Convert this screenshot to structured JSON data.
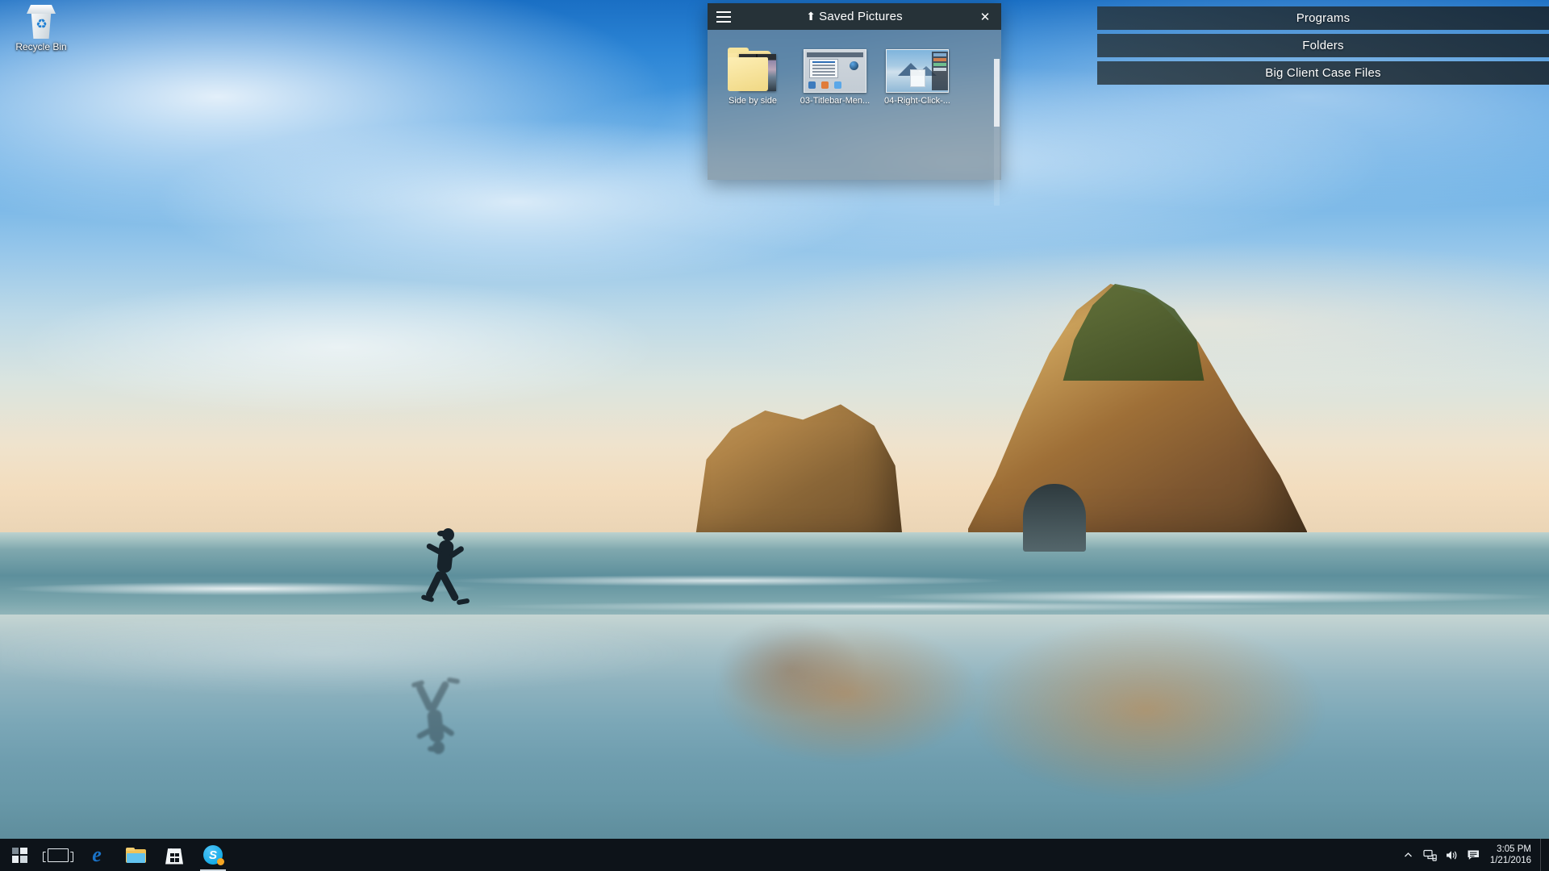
{
  "desktop": {
    "icons": [
      {
        "label": "Recycle Bin",
        "icon": "recycle-bin-icon"
      }
    ]
  },
  "explorer_window": {
    "title": "Saved Pictures",
    "title_prefix_icon": "up-arrow-icon",
    "menu_icon": "hamburger-menu-icon",
    "close_label": "✕",
    "files": [
      {
        "name": "Side by side",
        "type": "folder",
        "icon": "folder-with-preview-icon"
      },
      {
        "name": "03-Titlebar-Men...",
        "type": "image",
        "icon": "screenshot-thumbnail-icon"
      },
      {
        "name": "04-Right-Click-...",
        "type": "image",
        "icon": "screenshot-thumbnail-icon"
      }
    ]
  },
  "menu_bars": {
    "items": [
      {
        "label": "Programs"
      },
      {
        "label": "Folders"
      },
      {
        "label": "Big Client Case Files"
      }
    ]
  },
  "taskbar": {
    "buttons": [
      {
        "name": "start-button",
        "icon": "windows-start-icon"
      },
      {
        "name": "task-view-button",
        "icon": "task-view-icon"
      },
      {
        "name": "edge-button",
        "icon": "edge-browser-icon",
        "glyph": "e"
      },
      {
        "name": "file-explorer-button",
        "icon": "file-explorer-icon"
      },
      {
        "name": "store-button",
        "icon": "microsoft-store-icon"
      },
      {
        "name": "skype-button",
        "icon": "skype-icon",
        "glyph": "S",
        "running": true,
        "badge": true
      }
    ],
    "tray": [
      {
        "name": "show-hidden-icons",
        "icon": "chevron-up-icon",
        "glyph": "⌃"
      },
      {
        "name": "network-icon",
        "icon": "network-icon"
      },
      {
        "name": "volume-icon",
        "icon": "speaker-icon"
      },
      {
        "name": "action-center-icon",
        "icon": "notification-icon"
      }
    ],
    "clock": {
      "time": "3:05 PM",
      "date": "1/21/2016"
    }
  },
  "colors": {
    "titlebar": "#263238",
    "taskbar": "#0d1319",
    "menubar": "#1e2a32",
    "accent_blue": "#1a73c8",
    "skype_badge": "#f5a623"
  }
}
